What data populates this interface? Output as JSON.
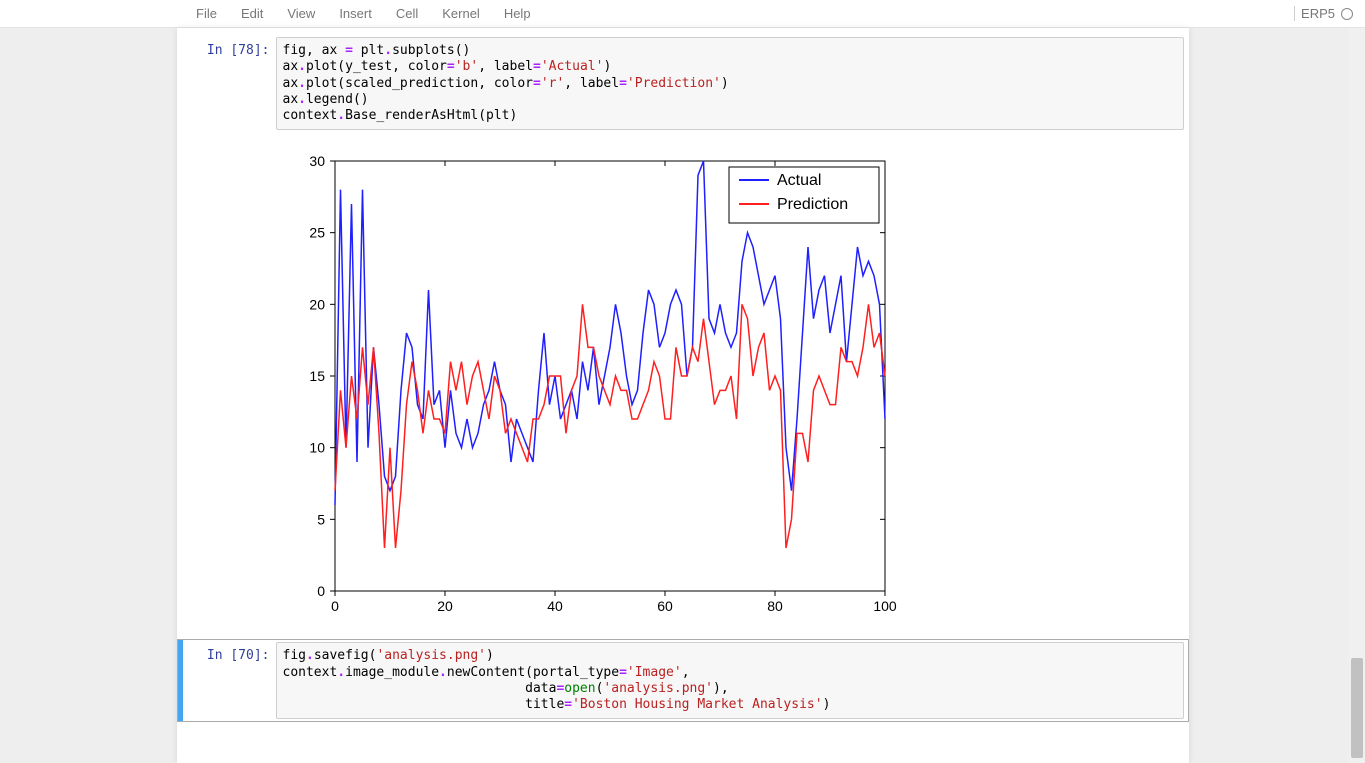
{
  "menubar": {
    "items": [
      "File",
      "Edit",
      "View",
      "Insert",
      "Cell",
      "Kernel",
      "Help"
    ],
    "kernel_name": "ERP5"
  },
  "cells": [
    {
      "prompt": "In [78]:",
      "code_tokens": [
        [
          "var",
          "fig"
        ],
        [
          "punct",
          ", "
        ],
        [
          "var",
          "ax"
        ],
        [
          "punct",
          " "
        ],
        [
          "op",
          "="
        ],
        [
          "punct",
          " "
        ],
        [
          "var",
          "plt"
        ],
        [
          "op",
          "."
        ],
        [
          "fn",
          "subplots"
        ],
        [
          "punct",
          "()\n"
        ],
        [
          "var",
          "ax"
        ],
        [
          "op",
          "."
        ],
        [
          "fn",
          "plot"
        ],
        [
          "punct",
          "("
        ],
        [
          "var",
          "y_test"
        ],
        [
          "punct",
          ", "
        ],
        [
          "var",
          "color"
        ],
        [
          "op",
          "="
        ],
        [
          "str",
          "'b'"
        ],
        [
          "punct",
          ", "
        ],
        [
          "var",
          "label"
        ],
        [
          "op",
          "="
        ],
        [
          "str",
          "'Actual'"
        ],
        [
          "punct",
          ")\n"
        ],
        [
          "var",
          "ax"
        ],
        [
          "op",
          "."
        ],
        [
          "fn",
          "plot"
        ],
        [
          "punct",
          "("
        ],
        [
          "var",
          "scaled_prediction"
        ],
        [
          "punct",
          ", "
        ],
        [
          "var",
          "color"
        ],
        [
          "op",
          "="
        ],
        [
          "str",
          "'r'"
        ],
        [
          "punct",
          ", "
        ],
        [
          "var",
          "label"
        ],
        [
          "op",
          "="
        ],
        [
          "str",
          "'Prediction'"
        ],
        [
          "punct",
          ")\n"
        ],
        [
          "var",
          "ax"
        ],
        [
          "op",
          "."
        ],
        [
          "fn",
          "legend"
        ],
        [
          "punct",
          "()\n"
        ],
        [
          "var",
          "context"
        ],
        [
          "op",
          "."
        ],
        [
          "fn",
          "Base_renderAsHtml"
        ],
        [
          "punct",
          "("
        ],
        [
          "var",
          "plt"
        ],
        [
          "punct",
          ")"
        ]
      ]
    },
    {
      "prompt": "In [70]:",
      "selected": true,
      "code_tokens": [
        [
          "var",
          "fig"
        ],
        [
          "op",
          "."
        ],
        [
          "fn",
          "savefig"
        ],
        [
          "punct",
          "("
        ],
        [
          "str",
          "'analysis.png'"
        ],
        [
          "punct",
          ")\n"
        ],
        [
          "var",
          "context"
        ],
        [
          "op",
          "."
        ],
        [
          "var",
          "image_module"
        ],
        [
          "op",
          "."
        ],
        [
          "fn",
          "newContent"
        ],
        [
          "punct",
          "("
        ],
        [
          "var",
          "portal_type"
        ],
        [
          "op",
          "="
        ],
        [
          "str",
          "'Image'"
        ],
        [
          "punct",
          ",\n"
        ],
        [
          "punct",
          "                               "
        ],
        [
          "var",
          "data"
        ],
        [
          "op",
          "="
        ],
        [
          "builtin",
          "open"
        ],
        [
          "punct",
          "("
        ],
        [
          "str",
          "'analysis.png'"
        ],
        [
          "punct",
          "),\n"
        ],
        [
          "punct",
          "                               "
        ],
        [
          "var",
          "title"
        ],
        [
          "op",
          "="
        ],
        [
          "str",
          "'Boston Housing Market Analysis'"
        ],
        [
          "punct",
          ")"
        ]
      ]
    }
  ],
  "chart_data": {
    "type": "line",
    "title": "",
    "xlabel": "",
    "ylabel": "",
    "xlim": [
      0,
      100
    ],
    "ylim": [
      0,
      30
    ],
    "xticks": [
      0,
      20,
      40,
      60,
      80,
      100
    ],
    "yticks": [
      0,
      5,
      10,
      15,
      20,
      25,
      30
    ],
    "legend": {
      "position": "upper right",
      "entries": [
        "Actual",
        "Prediction"
      ]
    },
    "series": [
      {
        "name": "Actual",
        "color": "#1f1fff",
        "x": [
          0,
          1,
          2,
          3,
          4,
          5,
          6,
          7,
          8,
          9,
          10,
          11,
          12,
          13,
          14,
          15,
          16,
          17,
          18,
          19,
          20,
          21,
          22,
          23,
          24,
          25,
          26,
          27,
          28,
          29,
          30,
          31,
          32,
          33,
          34,
          35,
          36,
          37,
          38,
          39,
          40,
          41,
          42,
          43,
          44,
          45,
          46,
          47,
          48,
          49,
          50,
          51,
          52,
          53,
          54,
          55,
          56,
          57,
          58,
          59,
          60,
          61,
          62,
          63,
          64,
          65,
          66,
          67,
          68,
          69,
          70,
          71,
          72,
          73,
          74,
          75,
          76,
          77,
          78,
          79,
          80,
          81,
          82,
          83,
          84,
          85,
          86,
          87,
          88,
          89,
          90,
          91,
          92,
          93,
          94,
          95,
          96,
          97,
          98,
          99,
          100
        ],
        "values": [
          6,
          28,
          10,
          27,
          9,
          28,
          10,
          17,
          13,
          8,
          7,
          8,
          14,
          18,
          17,
          13,
          12,
          21,
          13,
          14,
          10,
          14,
          11,
          10,
          12,
          10,
          11,
          13,
          14,
          16,
          14,
          13,
          9,
          12,
          11,
          10,
          9,
          14,
          18,
          13,
          15,
          12,
          13,
          14,
          12,
          16,
          14,
          17,
          13,
          15,
          17,
          20,
          18,
          15,
          13,
          14,
          18,
          21,
          20,
          17,
          18,
          20,
          21,
          20,
          15,
          17,
          29,
          30,
          19,
          18,
          20,
          18,
          17,
          18,
          23,
          25,
          24,
          22,
          20,
          21,
          22,
          19,
          10,
          7,
          12,
          18,
          24,
          19,
          21,
          22,
          18,
          20,
          22,
          16,
          20,
          24,
          22,
          23,
          22,
          20,
          12
        ]
      },
      {
        "name": "Prediction",
        "color": "#ff1f1f",
        "x": [
          0,
          1,
          2,
          3,
          4,
          5,
          6,
          7,
          8,
          9,
          10,
          11,
          12,
          13,
          14,
          15,
          16,
          17,
          18,
          19,
          20,
          21,
          22,
          23,
          24,
          25,
          26,
          27,
          28,
          29,
          30,
          31,
          32,
          33,
          34,
          35,
          36,
          37,
          38,
          39,
          40,
          41,
          42,
          43,
          44,
          45,
          46,
          47,
          48,
          49,
          50,
          51,
          52,
          53,
          54,
          55,
          56,
          57,
          58,
          59,
          60,
          61,
          62,
          63,
          64,
          65,
          66,
          67,
          68,
          69,
          70,
          71,
          72,
          73,
          74,
          75,
          76,
          77,
          78,
          79,
          80,
          81,
          82,
          83,
          84,
          85,
          86,
          87,
          88,
          89,
          90,
          91,
          92,
          93,
          94,
          95,
          96,
          97,
          98,
          99,
          100
        ],
        "values": [
          7,
          14,
          10,
          15,
          12,
          17,
          13,
          17,
          11,
          3,
          10,
          3,
          7,
          13,
          16,
          14,
          11,
          14,
          12,
          12,
          11,
          16,
          14,
          16,
          13,
          15,
          16,
          14,
          12,
          15,
          14,
          11,
          12,
          11,
          10,
          9,
          12,
          12,
          13,
          15,
          15,
          15,
          11,
          14,
          15,
          20,
          17,
          17,
          15,
          14,
          13,
          15,
          14,
          14,
          12,
          12,
          13,
          14,
          16,
          15,
          12,
          12,
          17,
          15,
          15,
          17,
          16,
          19,
          16,
          13,
          14,
          14,
          15,
          12,
          20,
          19,
          15,
          17,
          18,
          14,
          15,
          14,
          3,
          5,
          11,
          11,
          9,
          14,
          15,
          14,
          13,
          13,
          17,
          16,
          16,
          15,
          17,
          20,
          17,
          18,
          15
        ]
      }
    ]
  }
}
